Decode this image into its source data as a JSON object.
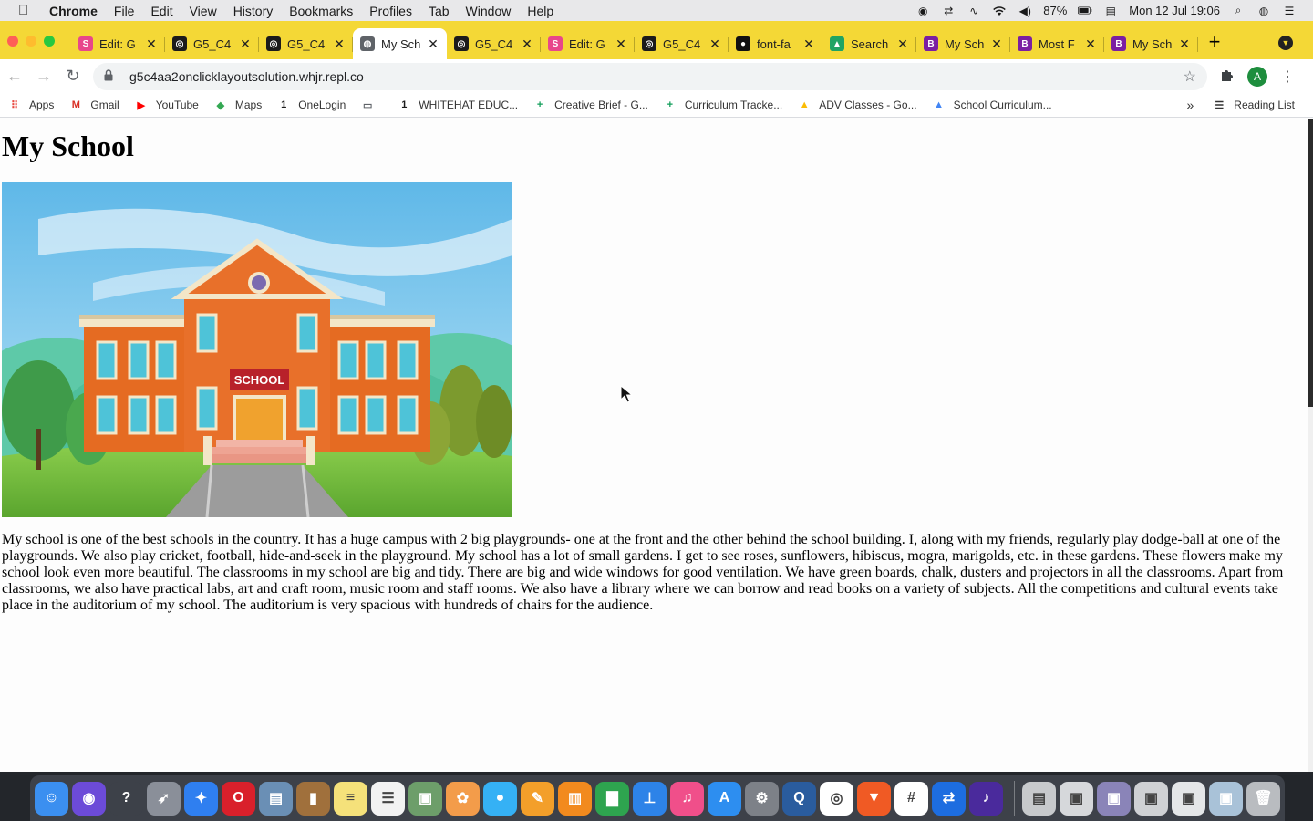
{
  "menubar": {
    "app": "Chrome",
    "items": [
      "File",
      "Edit",
      "View",
      "History",
      "Bookmarks",
      "Profiles",
      "Tab",
      "Window",
      "Help"
    ],
    "battery": "87%",
    "datetime": "Mon 12 Jul  19:06"
  },
  "tabs": [
    {
      "title": "Edit: G",
      "icon": "s-logo-icon",
      "color": "#e8478b",
      "glyph": "S"
    },
    {
      "title": "G5_C4",
      "icon": "replit-icon",
      "color": "#1b1b1b",
      "glyph": "◎"
    },
    {
      "title": "G5_C4",
      "icon": "replit-icon",
      "color": "#1b1b1b",
      "glyph": "◎"
    },
    {
      "title": "My Sch",
      "icon": "globe-icon",
      "color": "#5f6368",
      "glyph": "◍",
      "active": true
    },
    {
      "title": "G5_C4",
      "icon": "replit-icon",
      "color": "#1b1b1b",
      "glyph": "◎"
    },
    {
      "title": "Edit: G",
      "icon": "s-logo-icon",
      "color": "#e8478b",
      "glyph": "S"
    },
    {
      "title": "G5_C4",
      "icon": "replit-icon",
      "color": "#1b1b1b",
      "glyph": "◎"
    },
    {
      "title": "font-fa",
      "icon": "github-icon",
      "color": "#111111",
      "glyph": "●"
    },
    {
      "title": "Search",
      "icon": "drive-icon",
      "color": "#1fa463",
      "glyph": "▲"
    },
    {
      "title": "My Sch",
      "icon": "bootstrap-icon",
      "color": "#7b1fa2",
      "glyph": "B"
    },
    {
      "title": "Most F",
      "icon": "bootstrap-icon",
      "color": "#7b1fa2",
      "glyph": "B"
    },
    {
      "title": "My Sch",
      "icon": "bootstrap-icon",
      "color": "#7b1fa2",
      "glyph": "B"
    }
  ],
  "toolbar": {
    "url": "g5c4aa2onclicklayoutsolution.whjr.repl.co",
    "avatar_letter": "A"
  },
  "bookmarks": {
    "items": [
      {
        "label": "Apps",
        "icon": "apps-grid-icon",
        "glyph": "⠿",
        "color": "#e8453c"
      },
      {
        "label": "Gmail",
        "icon": "gmail-icon",
        "glyph": "M",
        "color": "#d93025"
      },
      {
        "label": "YouTube",
        "icon": "youtube-icon",
        "glyph": "▶",
        "color": "#ff0000"
      },
      {
        "label": "Maps",
        "icon": "maps-icon",
        "glyph": "◆",
        "color": "#34a853"
      },
      {
        "label": "OneLogin",
        "icon": "onelogin-icon",
        "glyph": "1",
        "color": "#1b1b1b"
      },
      {
        "label": "",
        "icon": "folder-icon",
        "glyph": "▭",
        "color": "#5f6368"
      },
      {
        "label": "WHITEHAT EDUC...",
        "icon": "onelogin-icon",
        "glyph": "1",
        "color": "#1b1b1b"
      },
      {
        "label": "Creative Brief - G...",
        "icon": "sheets-plus-icon",
        "glyph": "+",
        "color": "#0f9d58"
      },
      {
        "label": "Curriculum Tracke...",
        "icon": "sheets-plus-icon",
        "glyph": "+",
        "color": "#0f9d58"
      },
      {
        "label": "ADV Classes - Go...",
        "icon": "drive-icon",
        "glyph": "▲",
        "color": "#fbbc04"
      },
      {
        "label": "School Curriculum...",
        "icon": "drive-icon",
        "glyph": "▲",
        "color": "#4285f4"
      }
    ],
    "overflow": "»",
    "reading_list": "Reading List"
  },
  "page": {
    "heading": "My School",
    "image_label": "SCHOOL",
    "paragraph": "My school is one of the best schools in the country. It has a huge campus with 2 big playgrounds- one at the front and the other behind the school building. I, along with my friends, regularly play dodge-ball at one of the playgrounds. We also play cricket, football, hide-and-seek in the playground. My school has a lot of small gardens. I get to see roses, sunflowers, hibiscus, mogra, marigolds, etc. in these gardens. These flowers make my school look even more beautiful. The classrooms in my school are big and tidy. There are big and wide windows for good ventilation. We have green boards, chalk, dusters and projectors in all the classrooms. Apart from classrooms, we also have practical labs, art and craft room, music room and staff rooms. We also have a library where we can borrow and read books on a variety of subjects. All the competitions and cultural events take place in the auditorium of my school. The auditorium is very spacious with hundreds of chairs for the audience."
  },
  "dock": [
    {
      "name": "finder-icon",
      "color": "#3b8ff0",
      "glyph": "☺"
    },
    {
      "name": "siri-icon",
      "color": "#6c4bd8",
      "glyph": "◉"
    },
    {
      "name": "help-icon",
      "color": "#3d4149",
      "glyph": "?"
    },
    {
      "name": "launchpad-icon",
      "color": "#8a8f99",
      "glyph": "➶"
    },
    {
      "name": "safari-icon",
      "color": "#2f7ff0",
      "glyph": "✦"
    },
    {
      "name": "opera-icon",
      "color": "#d9202b",
      "glyph": "O"
    },
    {
      "name": "preview-icon",
      "color": "#6a8fb5",
      "glyph": "▤"
    },
    {
      "name": "contacts-icon",
      "color": "#a0703c",
      "glyph": "▮"
    },
    {
      "name": "notes-icon",
      "color": "#f5e17a",
      "glyph": "≡"
    },
    {
      "name": "reminders-icon",
      "color": "#f2f2f2",
      "glyph": "☰"
    },
    {
      "name": "image-capture-icon",
      "color": "#6d9e6a",
      "glyph": "▣"
    },
    {
      "name": "photos-icon",
      "color": "#f39c4a",
      "glyph": "✿"
    },
    {
      "name": "messages-icon",
      "color": "#35b1f5",
      "glyph": "●"
    },
    {
      "name": "pages-icon",
      "color": "#f39f2a",
      "glyph": "✎"
    },
    {
      "name": "books-icon",
      "color": "#f28a1e",
      "glyph": "▥"
    },
    {
      "name": "numbers-icon",
      "color": "#2ea44f",
      "glyph": "▇"
    },
    {
      "name": "keynote-icon",
      "color": "#2d83e8",
      "glyph": "⊥"
    },
    {
      "name": "itunes-icon",
      "color": "#f04f8a",
      "glyph": "♫"
    },
    {
      "name": "app-store-icon",
      "color": "#2d8ef0",
      "glyph": "A"
    },
    {
      "name": "system-preferences-icon",
      "color": "#7d8188",
      "glyph": "⚙"
    },
    {
      "name": "quicktime-icon",
      "color": "#2a5c9e",
      "glyph": "Q"
    },
    {
      "name": "chrome-icon",
      "color": "#ffffff",
      "glyph": "◎"
    },
    {
      "name": "brave-icon",
      "color": "#f05a24",
      "glyph": "▼"
    },
    {
      "name": "slack-icon",
      "color": "#ffffff",
      "glyph": "#"
    },
    {
      "name": "teamviewer-icon",
      "color": "#1d6de0",
      "glyph": "⇄"
    },
    {
      "name": "audio-app-icon",
      "color": "#4a2a9c",
      "glyph": "♪"
    },
    {
      "name": "separator"
    },
    {
      "name": "downloads-stack-icon",
      "color": "#c7c9cc",
      "glyph": "▤"
    },
    {
      "name": "screenshot-file-icon",
      "color": "#d6d8db",
      "glyph": "▣"
    },
    {
      "name": "screenshot-file-icon",
      "color": "#8a84b8",
      "glyph": "▣"
    },
    {
      "name": "screenshot-file-icon",
      "color": "#cfd1d4",
      "glyph": "▣"
    },
    {
      "name": "screenshot-file-icon",
      "color": "#e4e6e8",
      "glyph": "▣"
    },
    {
      "name": "screenshot-file-icon",
      "color": "#a9c2d8",
      "glyph": "▣"
    },
    {
      "name": "trash-icon",
      "color": "#b9bcc0",
      "glyph": "🗑"
    }
  ]
}
